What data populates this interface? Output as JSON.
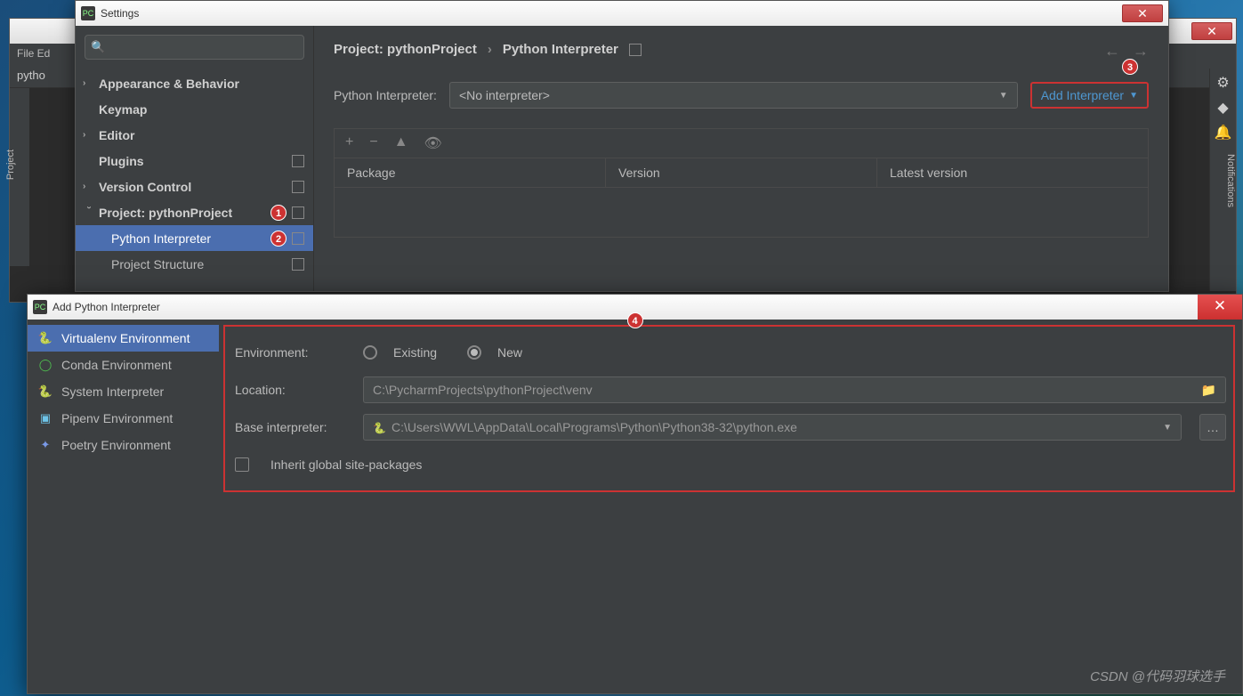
{
  "bg": {
    "title_prefix": "pytho",
    "menu": "File  Ed",
    "tab": "pytho",
    "left_label": "Project",
    "right_label": "Notifications"
  },
  "settings": {
    "title": "Settings",
    "search_placeholder": "",
    "tree": {
      "appearance": "Appearance & Behavior",
      "keymap": "Keymap",
      "editor": "Editor",
      "plugins": "Plugins",
      "vcs": "Version Control",
      "project": "Project: pythonProject",
      "interp": "Python Interpreter",
      "structure": "Project Structure"
    },
    "badges": {
      "b1": "1",
      "b2": "2",
      "b3": "3"
    },
    "breadcrumb": {
      "a": "Project: pythonProject",
      "b": "Python Interpreter"
    },
    "interp_label": "Python Interpreter:",
    "interp_value": "<No interpreter>",
    "add_interp": "Add Interpreter",
    "pkg_headers": {
      "pkg": "Package",
      "ver": "Version",
      "latest": "Latest version"
    }
  },
  "addpy": {
    "title": "Add Python Interpreter",
    "badge4": "4",
    "envs": {
      "venv": "Virtualenv Environment",
      "conda": "Conda Environment",
      "sys": "System Interpreter",
      "pipenv": "Pipenv Environment",
      "poetry": "Poetry Environment"
    },
    "form": {
      "env_label": "Environment:",
      "existing": "Existing",
      "new": "New",
      "location_label": "Location:",
      "location_value": "C:\\PycharmProjects\\pythonProject\\venv",
      "base_label": "Base interpreter:",
      "base_value": "C:\\Users\\WWL\\AppData\\Local\\Programs\\Python\\Python38-32\\python.exe",
      "inherit": "Inherit global site-packages"
    }
  },
  "watermark": "CSDN @代码羽球选手"
}
